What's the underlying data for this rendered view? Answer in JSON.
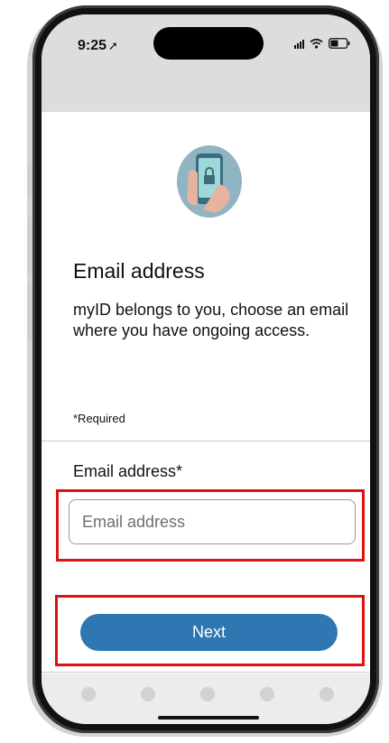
{
  "status_bar": {
    "time": "9:25",
    "location_icon": "location-arrow-icon",
    "signal_icon": "signal-bars-icon",
    "wifi_icon": "wifi-icon",
    "battery_icon": "battery-icon"
  },
  "illustration": {
    "icon": "phone-lock-icon"
  },
  "page": {
    "heading": "Email address",
    "description": "myID belongs to you, choose an email where you have ongoing access.",
    "required_note": "*Required"
  },
  "form": {
    "email_label": "Email address*",
    "email_placeholder": "Email address",
    "email_value": ""
  },
  "actions": {
    "next_label": "Next"
  },
  "colors": {
    "primary_button": "#2e77b2",
    "highlight": "#e01010",
    "illustration_bg": "#8fb4c2"
  }
}
